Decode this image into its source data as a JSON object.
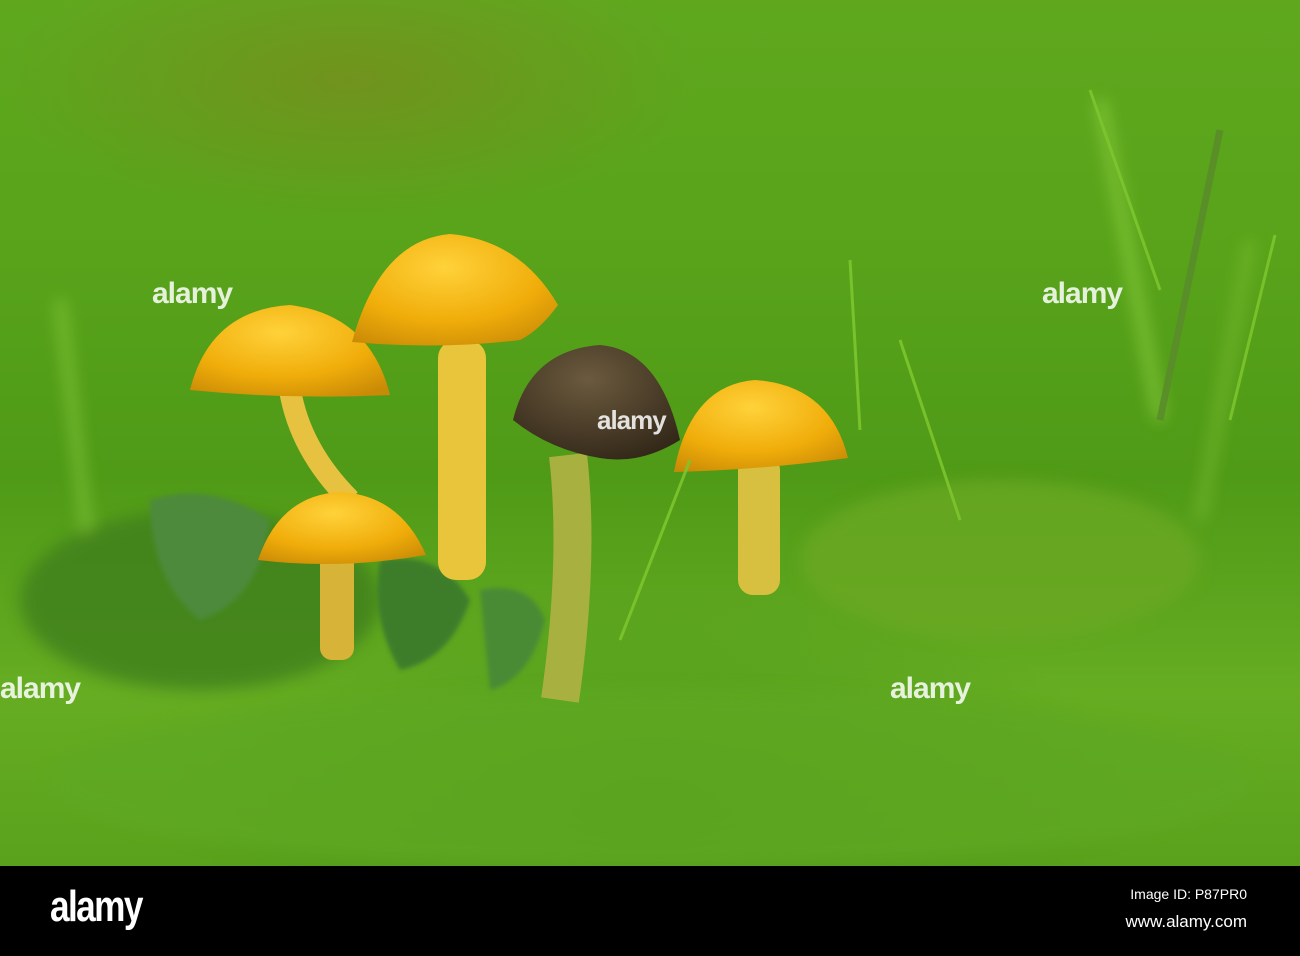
{
  "watermark": {
    "brand": "alamy"
  },
  "footer": {
    "logo": "alamy",
    "image_id": "Image ID: P87PR0",
    "url": "www.alamy.com"
  }
}
